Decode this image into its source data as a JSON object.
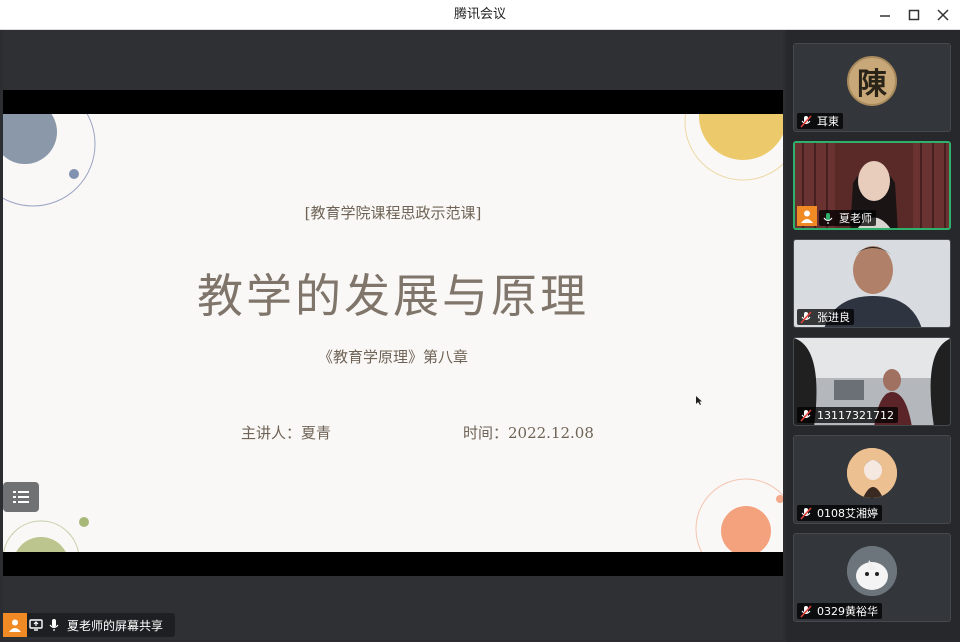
{
  "window": {
    "title": "腾讯会议"
  },
  "slide": {
    "subtitle": "[教育学院课程思政示范课]",
    "title": "教学的发展与原理",
    "chapter": "《教育学原理》第八章",
    "presenter": "主讲人：夏青",
    "date": "时间：2022.12.08"
  },
  "share_bar": {
    "label": "夏老师的屏幕共享"
  },
  "participants": [
    {
      "name": "耳東",
      "avatar_text": "陳",
      "mic": "muted"
    },
    {
      "name": "夏老师",
      "mic": "on",
      "active": true,
      "host": true
    },
    {
      "name": "张进良",
      "mic": "muted"
    },
    {
      "name": "13117321712",
      "mic": "muted"
    },
    {
      "name": "0108艾湘婷",
      "mic": "muted"
    },
    {
      "name": "0329黄裕华",
      "mic": "muted"
    }
  ],
  "colors": {
    "accent_green": "#2fb06b",
    "host_orange": "#f08a24",
    "mute_red": "#e0403a"
  }
}
